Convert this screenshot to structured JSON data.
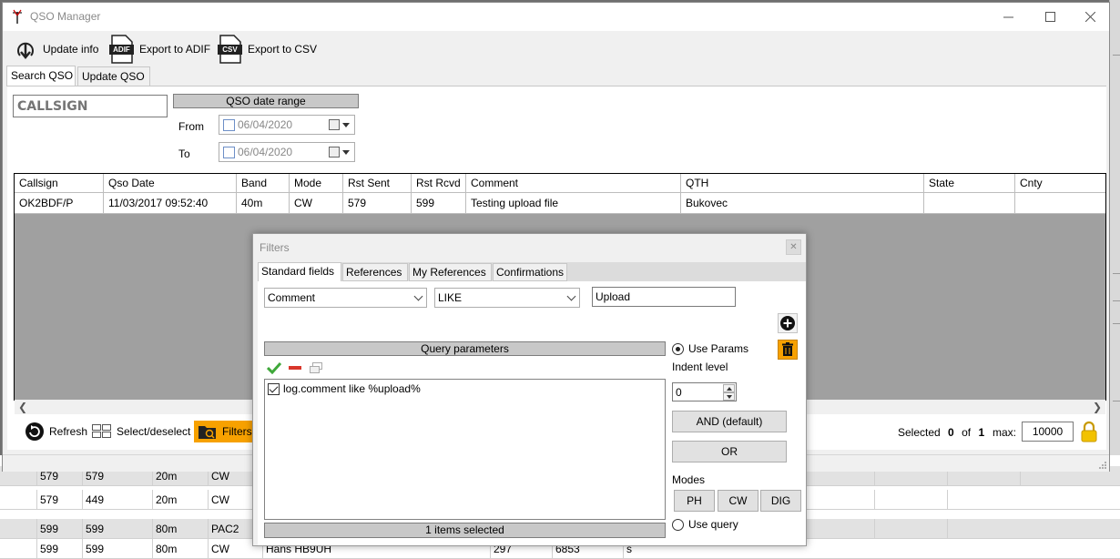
{
  "window": {
    "title": "QSO Manager"
  },
  "toolbar": {
    "update_info": "Update info",
    "export_adif": "Export to ADIF",
    "export_csv": "Export to CSV",
    "adif_badge": "ADIF",
    "csv_badge": "CSV"
  },
  "main_tabs": [
    "Search QSO",
    "Update QSO"
  ],
  "search": {
    "callsign_placeholder": "CALLSIGN",
    "date_range_label": "QSO date range",
    "from_label": "From",
    "to_label": "To",
    "from_date": "06/04/2020",
    "to_date": "06/04/2020"
  },
  "grid": {
    "columns": [
      "Callsign",
      "Qso Date",
      "Band",
      "Mode",
      "Rst Sent",
      "Rst Rcvd",
      "Comment",
      "QTH",
      "State",
      "Cnty"
    ],
    "rows": [
      [
        "OK2BDF/P",
        "11/03/2017 09:52:40",
        "40m",
        "CW",
        "579",
        "599",
        "Testing upload file",
        "Bukovec",
        "",
        ""
      ]
    ]
  },
  "bottom_bar": {
    "refresh": "Refresh",
    "select_deselect": "Select/deselect",
    "filters": "Filters",
    "selected_label": "Selected",
    "selected_count": "0",
    "of_label": "of",
    "total_count": "1",
    "max_label": "max:",
    "max_value": "10000"
  },
  "background_rows": [
    [
      "579",
      "579",
      "20m",
      "CW",
      "",
      "",
      "",
      ""
    ],
    [
      "579",
      "449",
      "20m",
      "CW",
      "",
      "",
      "",
      ""
    ],
    [
      "599",
      "599",
      "80m",
      "PAC2",
      "",
      "",
      "",
      ""
    ],
    [
      "599",
      "599",
      "80m",
      "CW",
      "Hans HB9UH",
      "297",
      "6853",
      "s"
    ]
  ],
  "filters_dialog": {
    "title": "Filters",
    "tabs": [
      "Standard fields",
      "References",
      "My References",
      "Confirmations"
    ],
    "field_combo": "Comment",
    "operator_combo": "LIKE",
    "value": "Upload",
    "query_params_header": "Query parameters",
    "items": [
      {
        "text": "log.comment like %upload%",
        "checked": true
      }
    ],
    "footer": "1 items selected",
    "use_params": "Use Params",
    "indent_label": "Indent level",
    "indent_value": "0",
    "and_button": "AND (default)",
    "or_button": "OR",
    "modes_label": "Modes",
    "mode_buttons": [
      "PH",
      "CW",
      "DIG"
    ],
    "use_query": "Use query"
  },
  "colors": {
    "filters_active": "#f7a100",
    "header_gray": "#c8c8c8",
    "grid_empty": "#a0a0a0"
  }
}
